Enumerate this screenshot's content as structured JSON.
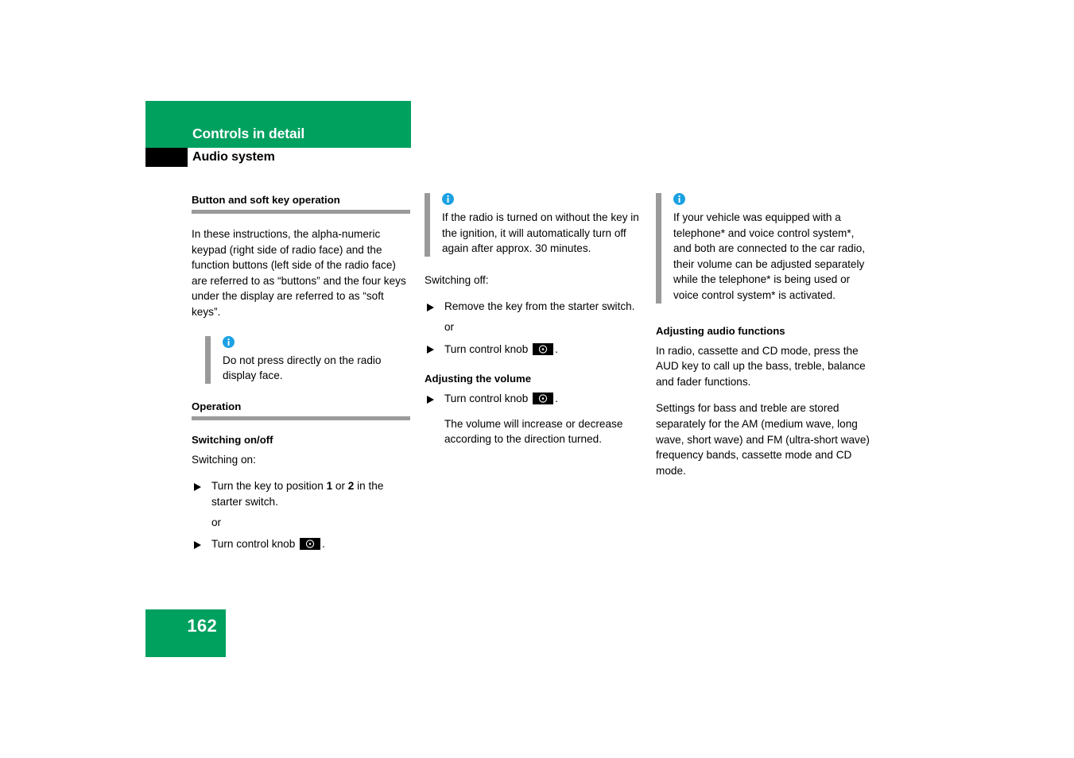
{
  "header": {
    "title": "Controls in detail",
    "subtitle": "Audio system",
    "green_color": "#00a05f",
    "tab_color": "#000000"
  },
  "column_1": {
    "section_heading": "Button and soft key operation",
    "intro_paragraph": "In these instructions, the alpha-numeric keypad (right side of radio face) and the function buttons (left side of the radio face) are referred to as “buttons” and the four keys under the display are referred to as “soft keys”.",
    "note": {
      "icon": "info-icon",
      "icon_color": "#1ba1e2",
      "text": "Do not press directly on the radio display face."
    },
    "operation_heading": "Operation",
    "switching_heading": "Switching on/off",
    "switching_on_label": "Switching on:",
    "step_1_pre": "Turn the key to position ",
    "step_1_num_a": "1",
    "step_1_mid": " or ",
    "step_1_num_b": "2",
    "step_1_post": " in the starter switch.",
    "or_label": "or",
    "step_2_pre": "Turn control knob ",
    "step_2_icon": "control-knob-icon",
    "step_2_post": "."
  },
  "column_2": {
    "note": {
      "icon": "info-icon",
      "icon_color": "#1ba1e2",
      "text": "If the radio is turned on without the key in the ignition, it will automatically turn off again after approx. 30 minutes."
    },
    "switching_off_label": "Switching off:",
    "step_1": "Remove the key from the starter switch.",
    "or_label": "or",
    "step_2_pre": "Turn control knob ",
    "step_2_icon": "control-knob-icon",
    "step_2_post": ".",
    "volume_heading": "Adjusting the volume",
    "volume_step_pre": "Turn control knob ",
    "volume_step_icon": "control-knob-icon",
    "volume_step_post": ".",
    "volume_note": "The volume will increase or decrease according to the direction turned."
  },
  "column_3": {
    "note": {
      "icon": "info-icon",
      "icon_color": "#1ba1e2",
      "text": "If your vehicle was equipped with a telephone* and voice control system*, and both are connected to the car radio, their volume can be adjusted separately while the telephone* is being used or voice control system* is activated."
    },
    "audio_heading": "Adjusting audio functions",
    "audio_paragraph_1": "In radio, cassette and CD mode, press the AUD key to call up the bass, treble, balance and fader functions.",
    "audio_paragraph_2": "Settings for bass and treble are stored separately for the AM (medium wave, long wave, short wave) and FM (ultra-short wave) frequency bands, cassette mode and CD mode."
  },
  "footer": {
    "page_number": "162",
    "box_color": "#00a05f"
  }
}
